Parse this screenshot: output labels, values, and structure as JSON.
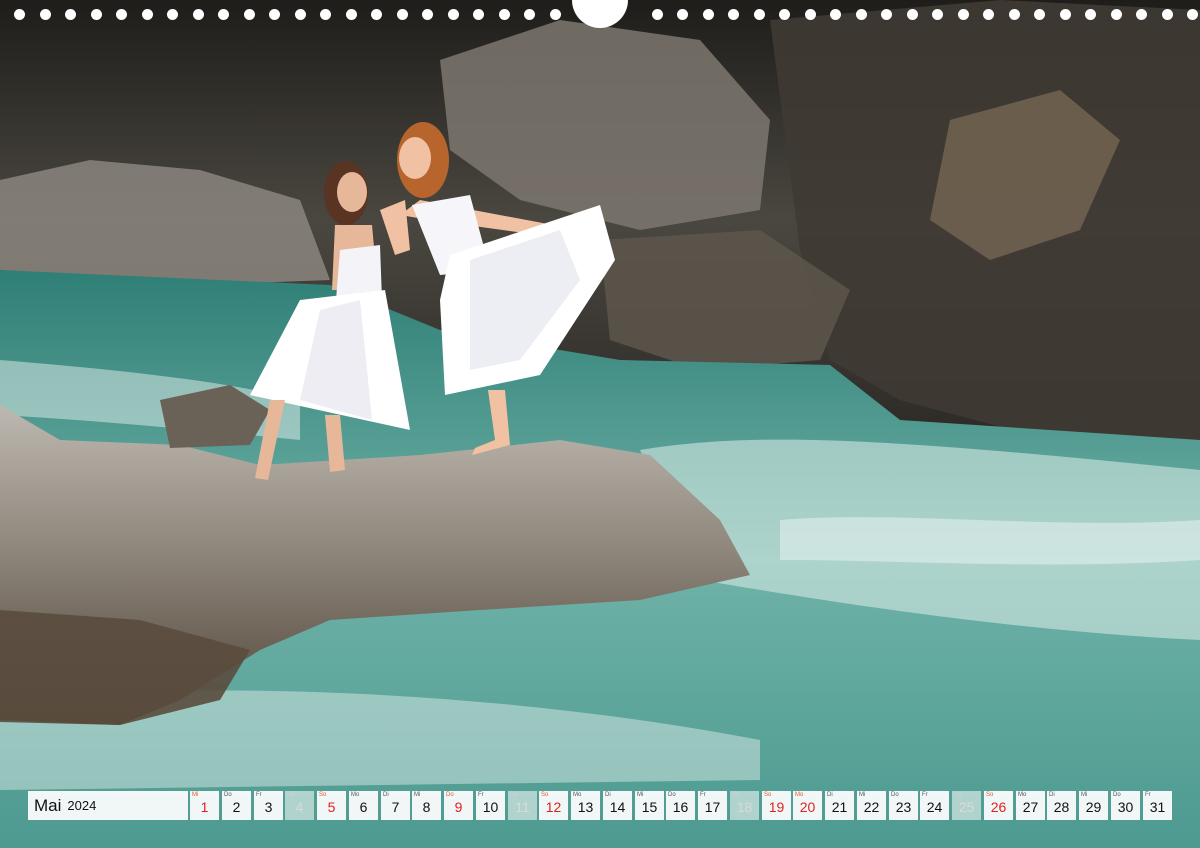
{
  "calendar": {
    "month": "Mai",
    "year": "2024",
    "days": [
      {
        "wd": "Mi",
        "num": "1",
        "kind": "holiday"
      },
      {
        "wd": "Do",
        "num": "2",
        "kind": "normal"
      },
      {
        "wd": "Fr",
        "num": "3",
        "kind": "normal"
      },
      {
        "wd": "Sa",
        "num": "4",
        "kind": "sat"
      },
      {
        "wd": "So",
        "num": "5",
        "kind": "holiday"
      },
      {
        "wd": "Mo",
        "num": "6",
        "kind": "normal"
      },
      {
        "wd": "Di",
        "num": "7",
        "kind": "normal"
      },
      {
        "wd": "Mi",
        "num": "8",
        "kind": "normal"
      },
      {
        "wd": "Do",
        "num": "9",
        "kind": "holiday"
      },
      {
        "wd": "Fr",
        "num": "10",
        "kind": "normal"
      },
      {
        "wd": "Sa",
        "num": "11",
        "kind": "sat"
      },
      {
        "wd": "So",
        "num": "12",
        "kind": "holiday"
      },
      {
        "wd": "Mo",
        "num": "13",
        "kind": "normal"
      },
      {
        "wd": "Di",
        "num": "14",
        "kind": "normal"
      },
      {
        "wd": "Mi",
        "num": "15",
        "kind": "normal"
      },
      {
        "wd": "Do",
        "num": "16",
        "kind": "normal"
      },
      {
        "wd": "Fr",
        "num": "17",
        "kind": "normal"
      },
      {
        "wd": "Sa",
        "num": "18",
        "kind": "sat"
      },
      {
        "wd": "So",
        "num": "19",
        "kind": "holiday"
      },
      {
        "wd": "Mo",
        "num": "20",
        "kind": "holiday"
      },
      {
        "wd": "Di",
        "num": "21",
        "kind": "normal"
      },
      {
        "wd": "Mi",
        "num": "22",
        "kind": "normal"
      },
      {
        "wd": "Do",
        "num": "23",
        "kind": "normal"
      },
      {
        "wd": "Fr",
        "num": "24",
        "kind": "normal"
      },
      {
        "wd": "Sa",
        "num": "25",
        "kind": "sat"
      },
      {
        "wd": "So",
        "num": "26",
        "kind": "holiday"
      },
      {
        "wd": "Mo",
        "num": "27",
        "kind": "normal"
      },
      {
        "wd": "Di",
        "num": "28",
        "kind": "normal"
      },
      {
        "wd": "Mi",
        "num": "29",
        "kind": "normal"
      },
      {
        "wd": "Do",
        "num": "30",
        "kind": "normal"
      },
      {
        "wd": "Fr",
        "num": "31",
        "kind": "normal"
      }
    ]
  },
  "colors": {
    "holiday": "#e02020",
    "water": "#3f8f85",
    "rock": "#5c554c",
    "dress": "#ffffff"
  }
}
